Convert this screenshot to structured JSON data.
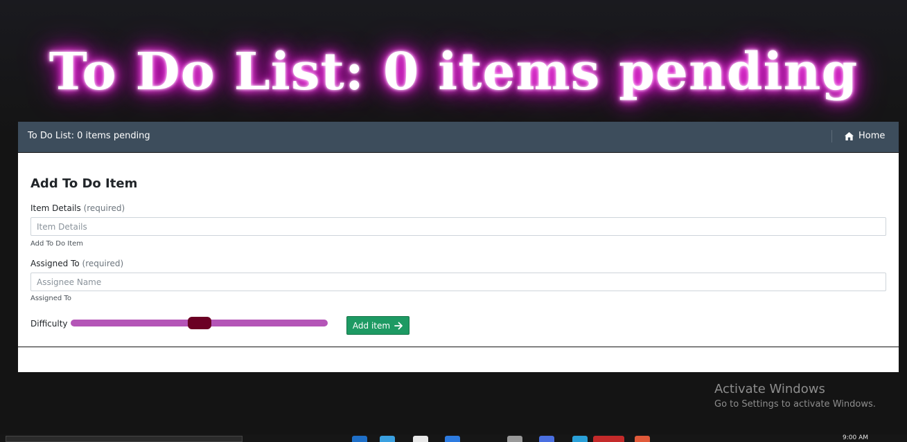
{
  "hero": {
    "title": "To Do List: 0 items pending"
  },
  "navbar": {
    "brand": "To Do List: 0 items pending",
    "home_label": "Home",
    "home_icon": "home-icon"
  },
  "form": {
    "title": "Add To Do Item",
    "item_details": {
      "label": "Item Details",
      "required": "(required)",
      "placeholder": "Item Details",
      "value": "",
      "help": "Add To Do Item"
    },
    "assigned_to": {
      "label": "Assigned To",
      "required": "(required)",
      "placeholder": "Assignee Name",
      "value": "",
      "help": "Assigned To"
    },
    "difficulty": {
      "label": "Difficulty",
      "value_fraction": 0.5
    },
    "add_button": {
      "label": "Add item",
      "icon": "arrow-right-icon"
    }
  },
  "watermark": {
    "title": "Activate Windows",
    "subtitle": "Go to Settings to activate Windows."
  },
  "taskbar": {
    "clock": "9:00 AM"
  },
  "colors": {
    "navbar_bg": "#3d4d5c",
    "slider_track": "#b455b7",
    "slider_thumb": "#6b0024",
    "button_bg": "#1d9a63",
    "glow": "#ff2ee6"
  }
}
